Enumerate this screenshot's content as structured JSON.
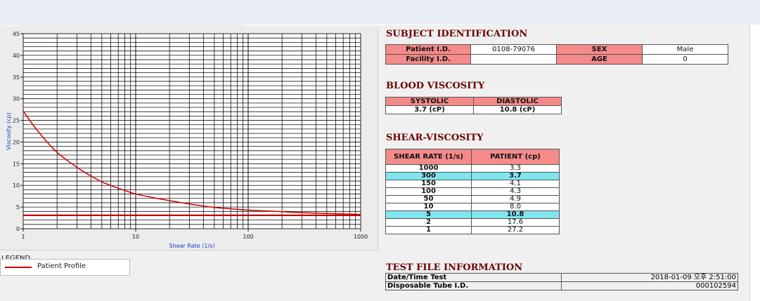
{
  "chart_data": {
    "type": "line",
    "xscale": "log",
    "xlim": [
      1,
      1000
    ],
    "ylim": [
      0,
      45
    ],
    "xticks": [
      "1",
      "10",
      "100",
      "1000"
    ],
    "yticks": [
      "0",
      "5",
      "10",
      "15",
      "20",
      "25",
      "30",
      "35",
      "40",
      "45"
    ],
    "xlabel": "Shear Rate (1/s)",
    "ylabel": "Viscosity (cp)",
    "grid": true,
    "series": [
      {
        "name": "Patient Profile",
        "color": "#cc0000",
        "x": [
          1,
          2,
          5,
          10,
          50,
          100,
          150,
          300,
          1000
        ],
        "y": [
          27.2,
          17.6,
          10.8,
          8.0,
          4.9,
          4.3,
          4.1,
          3.7,
          3.3
        ]
      },
      {
        "name": "",
        "color": "#cc0000",
        "x": [
          1,
          1000
        ],
        "y": [
          3.1,
          3.1
        ]
      }
    ],
    "legend": {
      "title": "LEGEND",
      "position": "bottom-left"
    }
  },
  "subject": {
    "title": "SUBJECT IDENTIFICATION",
    "patient_id_label": "Patient I.D.",
    "patient_id": "0108-79076",
    "sex_label": "SEX",
    "sex": "Male",
    "facility_label": "Facility I.D.",
    "facility": "",
    "age_label": "AGE",
    "age": "0"
  },
  "blood": {
    "title": "BLOOD VISCOSITY",
    "systolic_label": "SYSTOLIC",
    "diastolic_label": "DIASTOLIC",
    "systolic": "3.7 (cP)",
    "diastolic": "10.8 (cP)"
  },
  "shear": {
    "title": "SHEAR-VISCOSITY",
    "rate_label": "SHEAR RATE (1/s)",
    "patient_label": "PATIENT (cp)",
    "rows": [
      {
        "rate": "1000",
        "visc": "3.3",
        "hl": false
      },
      {
        "rate": "300",
        "visc": "3.7",
        "hl": true
      },
      {
        "rate": "150",
        "visc": "4.1",
        "hl": false
      },
      {
        "rate": "100",
        "visc": "4.3",
        "hl": false
      },
      {
        "rate": "50",
        "visc": "4.9",
        "hl": false
      },
      {
        "rate": "10",
        "visc": "8.0",
        "hl": false
      },
      {
        "rate": "5",
        "visc": "10.8",
        "hl": true
      },
      {
        "rate": "2",
        "visc": "17.6",
        "hl": false
      },
      {
        "rate": "1",
        "visc": "27.2",
        "hl": false
      }
    ]
  },
  "testfile": {
    "title": "TEST FILE INFORMATION",
    "date_label": "Date/Time Test",
    "date": "2018-01-09  오후 2:51:00",
    "tube_label": "Disposable Tube I.D.",
    "tube": "000102594"
  }
}
